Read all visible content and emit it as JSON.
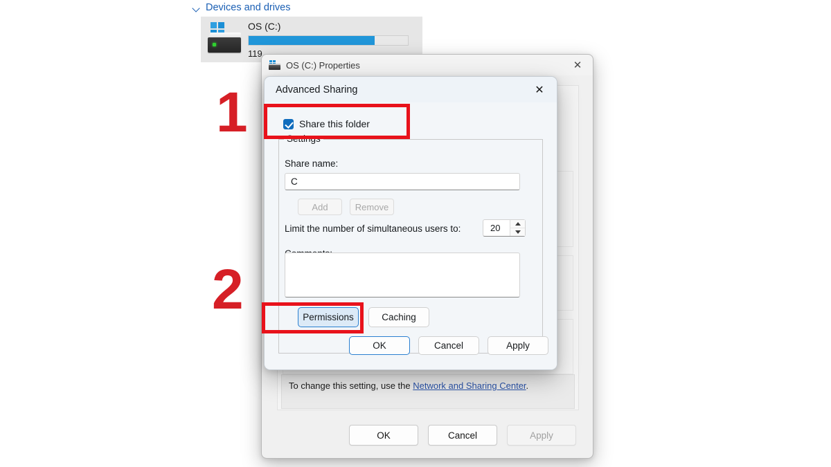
{
  "explorer": {
    "section_label": "Devices and drives",
    "chevron_icon": "chevron-down-icon",
    "drive": {
      "name": "OS (C:)",
      "free_text": "119",
      "usage_percent": 79,
      "icon": "hard-drive-icon"
    }
  },
  "properties_dialog": {
    "title": "OS (C:) Properties",
    "icon": "hard-drive-icon",
    "close_icon": "close-icon",
    "note_prefix": "To change this setting, use the ",
    "note_link": "Network and Sharing Center",
    "note_suffix": ".",
    "buttons": {
      "ok": "OK",
      "cancel": "Cancel",
      "apply": "Apply"
    }
  },
  "advanced_sharing": {
    "title": "Advanced Sharing",
    "close_icon": "close-icon",
    "share_checkbox": {
      "label": "Share this folder",
      "checked": true
    },
    "settings": {
      "group_label": "Settings",
      "share_name_label": "Share name:",
      "share_name_value": "C",
      "add_button": "Add",
      "remove_button": "Remove",
      "limit_label": "Limit the number of simultaneous users to:",
      "limit_value": "20",
      "comments_label": "Comments:",
      "comments_value": "",
      "permissions_button": "Permissions",
      "caching_button": "Caching"
    },
    "buttons": {
      "ok": "OK",
      "cancel": "Cancel",
      "apply": "Apply"
    }
  },
  "annotations": {
    "step_one": "1",
    "step_two": "2",
    "highlight_color": "#e8121b"
  }
}
